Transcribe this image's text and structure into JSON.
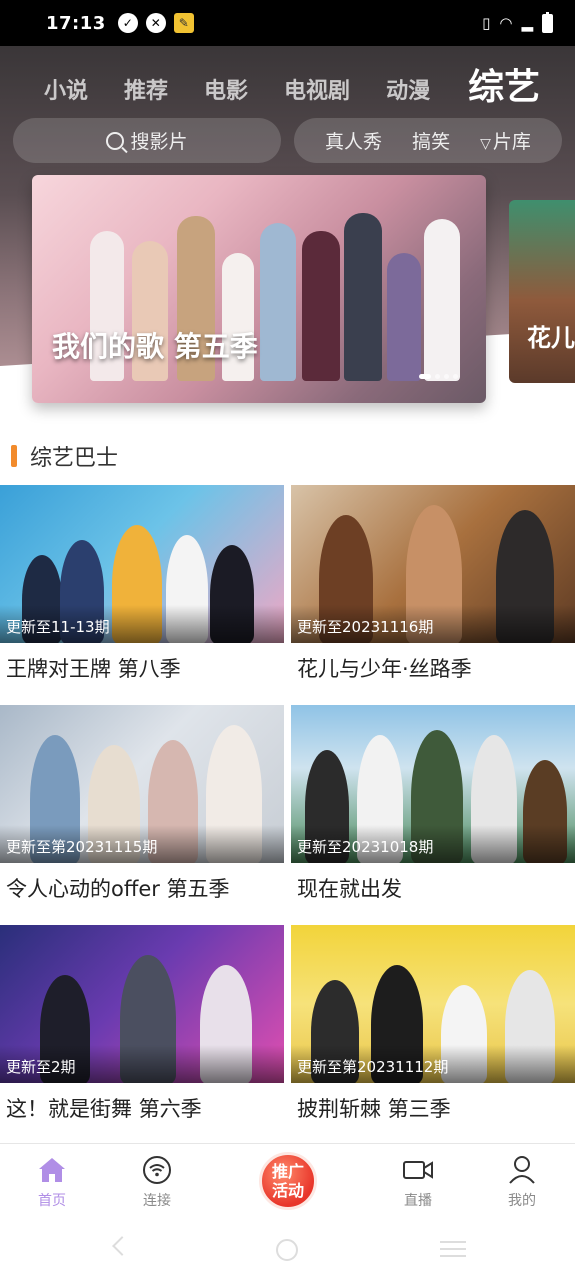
{
  "status": {
    "time": "17:13"
  },
  "top_tabs": [
    {
      "label": "小说"
    },
    {
      "label": "推荐"
    },
    {
      "label": "电影"
    },
    {
      "label": "电视剧"
    },
    {
      "label": "动漫"
    },
    {
      "label": "综艺",
      "active": true
    }
  ],
  "search": {
    "placeholder": "搜影片"
  },
  "filters": {
    "items": [
      "真人秀",
      "搞笑"
    ],
    "library_label": "片库"
  },
  "banner": {
    "title": "我们的歌 第五季",
    "next_title": "花儿",
    "current_index": 1,
    "total": 5
  },
  "section": {
    "title": "综艺巴士"
  },
  "cards": [
    {
      "title": "王牌对王牌 第八季",
      "update": "更新至11-13期"
    },
    {
      "title": "花儿与少年·丝路季",
      "update": "更新至20231116期"
    },
    {
      "title": "令人心动的offer 第五季",
      "update": "更新至第20231115期"
    },
    {
      "title": "现在就出发",
      "update": "更新至20231018期"
    },
    {
      "title": "这！就是街舞 第六季",
      "update": "更新至2期"
    },
    {
      "title": "披荆斩棘 第三季",
      "update": "更新至第20231112期"
    }
  ],
  "bottom_nav": {
    "home": "首页",
    "connect": "连接",
    "promo": "推广活动",
    "live": "直播",
    "mine": "我的"
  },
  "colors": {
    "accent": "#f28b2c",
    "active_nav": "#b08ee6",
    "promo": "#e8352a"
  }
}
